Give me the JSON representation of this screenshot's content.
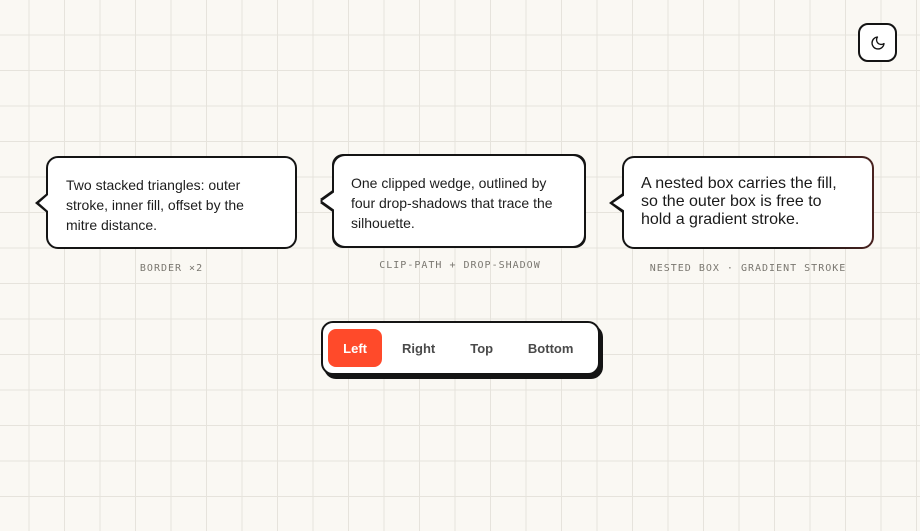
{
  "theme_toggle": {
    "icon": "moon-icon"
  },
  "demos": [
    {
      "text": "Two stacked triangles: outer stroke, inner fill, offset by the mitre distance.",
      "caption": "BORDER ×2"
    },
    {
      "text": "One clipped wedge, outlined by four drop-shadows that trace the silhouette.",
      "caption": "CLIP-PATH + DROP-SHADOW"
    },
    {
      "text": "A nested box carries the fill, so the outer box is free to hold a gradient stroke.",
      "caption": "NESTED BOX · GRADIENT STROKE"
    }
  ],
  "placement": {
    "options": [
      "Left",
      "Right",
      "Top",
      "Bottom"
    ],
    "selected": "Left"
  },
  "colors": {
    "accent": "#ff4a2a",
    "stroke": "#141414",
    "background": "#faf8f3"
  }
}
